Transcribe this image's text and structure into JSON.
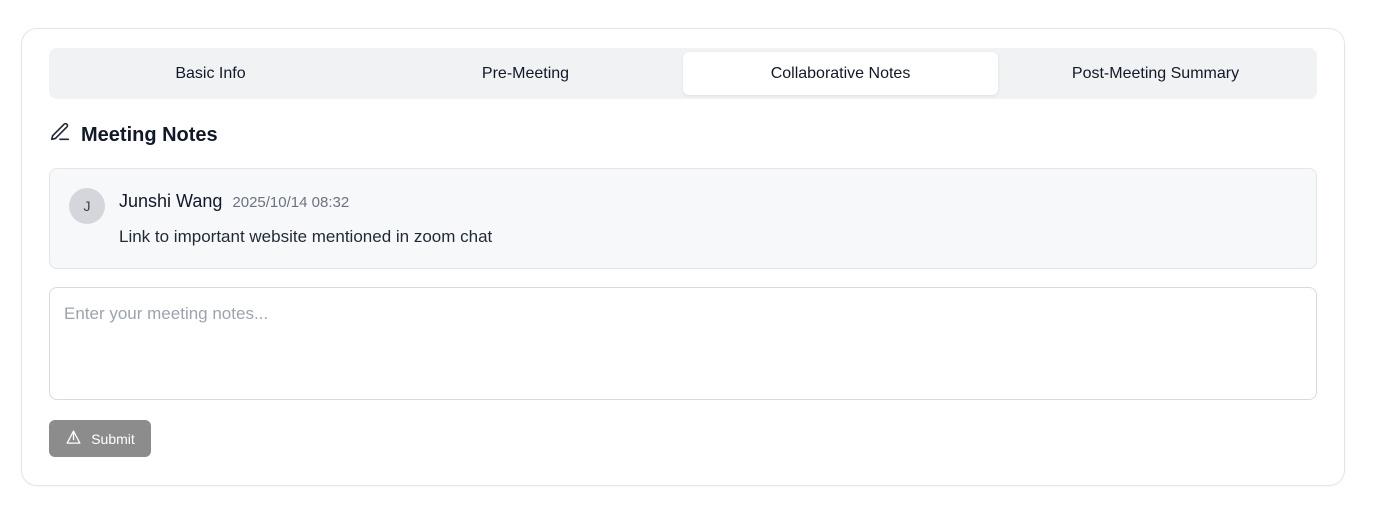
{
  "tabs": [
    {
      "label": "Basic Info",
      "active": false
    },
    {
      "label": "Pre-Meeting",
      "active": false
    },
    {
      "label": "Collaborative Notes",
      "active": true
    },
    {
      "label": "Post-Meeting Summary",
      "active": false
    }
  ],
  "section": {
    "title": "Meeting Notes",
    "icon": "pencil-icon"
  },
  "notes": [
    {
      "avatar_initial": "J",
      "author": "Junshi Wang",
      "timestamp": "2025/10/14 08:32",
      "text": "Link to important website mentioned in zoom chat"
    }
  ],
  "input": {
    "placeholder": "Enter your meeting notes...",
    "value": ""
  },
  "submit": {
    "label": "Submit",
    "icon": "send-icon",
    "disabled": true
  },
  "colors": {
    "submit_bg": "#8c8c8c",
    "tabs_bg": "#f1f2f3",
    "note_bg": "#f7f8fa",
    "avatar_bg": "#d4d6db"
  }
}
